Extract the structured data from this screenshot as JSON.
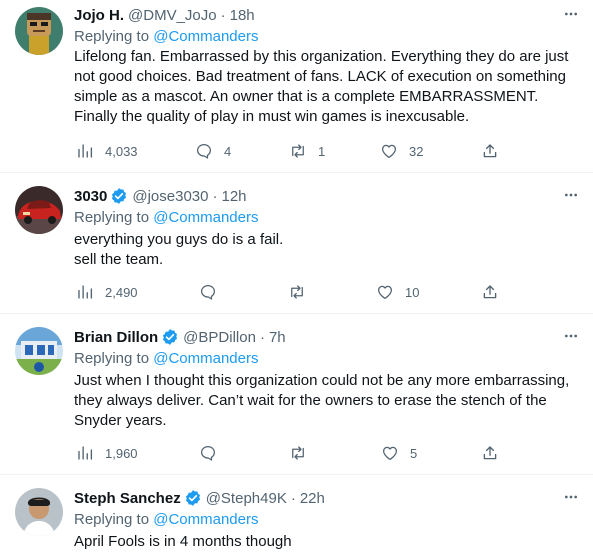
{
  "replying_to_prefix": "Replying to ",
  "tweets": [
    {
      "name": "Jojo H.",
      "handle": "@DMV_JoJo",
      "time": "18h",
      "reply_to": "@Commanders",
      "lines": [
        "Lifelong fan. Embarrassed by this organization. Everything they do are just",
        "not good choices. Bad treatment of fans. LACK of execution on something",
        "simple as a mascot. An owner that is a complete EMBARRASSMENT.",
        "Finally the quality of play in must win games is inexcusable."
      ],
      "views": "4,033",
      "replies": "4",
      "retweets": "1",
      "likes": "32"
    },
    {
      "name": "3030",
      "handle": "@jose3030",
      "time": "12h",
      "reply_to": "@Commanders",
      "lines": [
        "everything you guys do is a fail.",
        "sell the team."
      ],
      "views": "2,490",
      "replies": "",
      "retweets": "",
      "likes": "10"
    },
    {
      "name": "Brian Dillon",
      "handle": "@BPDillon",
      "time": "7h",
      "reply_to": "@Commanders",
      "lines": [
        "Just when I thought this organization could not be any more embarrassing,",
        "they always deliver. Can’t wait for the owners to erase the stench of the",
        "Snyder years."
      ],
      "views": "1,960",
      "replies": "",
      "retweets": "",
      "likes": "5"
    },
    {
      "name": "Steph Sanchez",
      "handle": "@Steph49K",
      "time": "22h",
      "reply_to": "@Commanders",
      "lines": [
        "April Fools is in 4 months though"
      ]
    }
  ],
  "colors": {
    "text": "#0f1419",
    "secondary": "#536471",
    "link": "#1d9bf0",
    "verified": "#1d9bf0",
    "divider": "#eff3f4"
  },
  "icons": [
    "views-icon",
    "reply-icon",
    "retweet-icon",
    "like-icon",
    "share-icon",
    "more-icon",
    "verified-badge-icon"
  ]
}
